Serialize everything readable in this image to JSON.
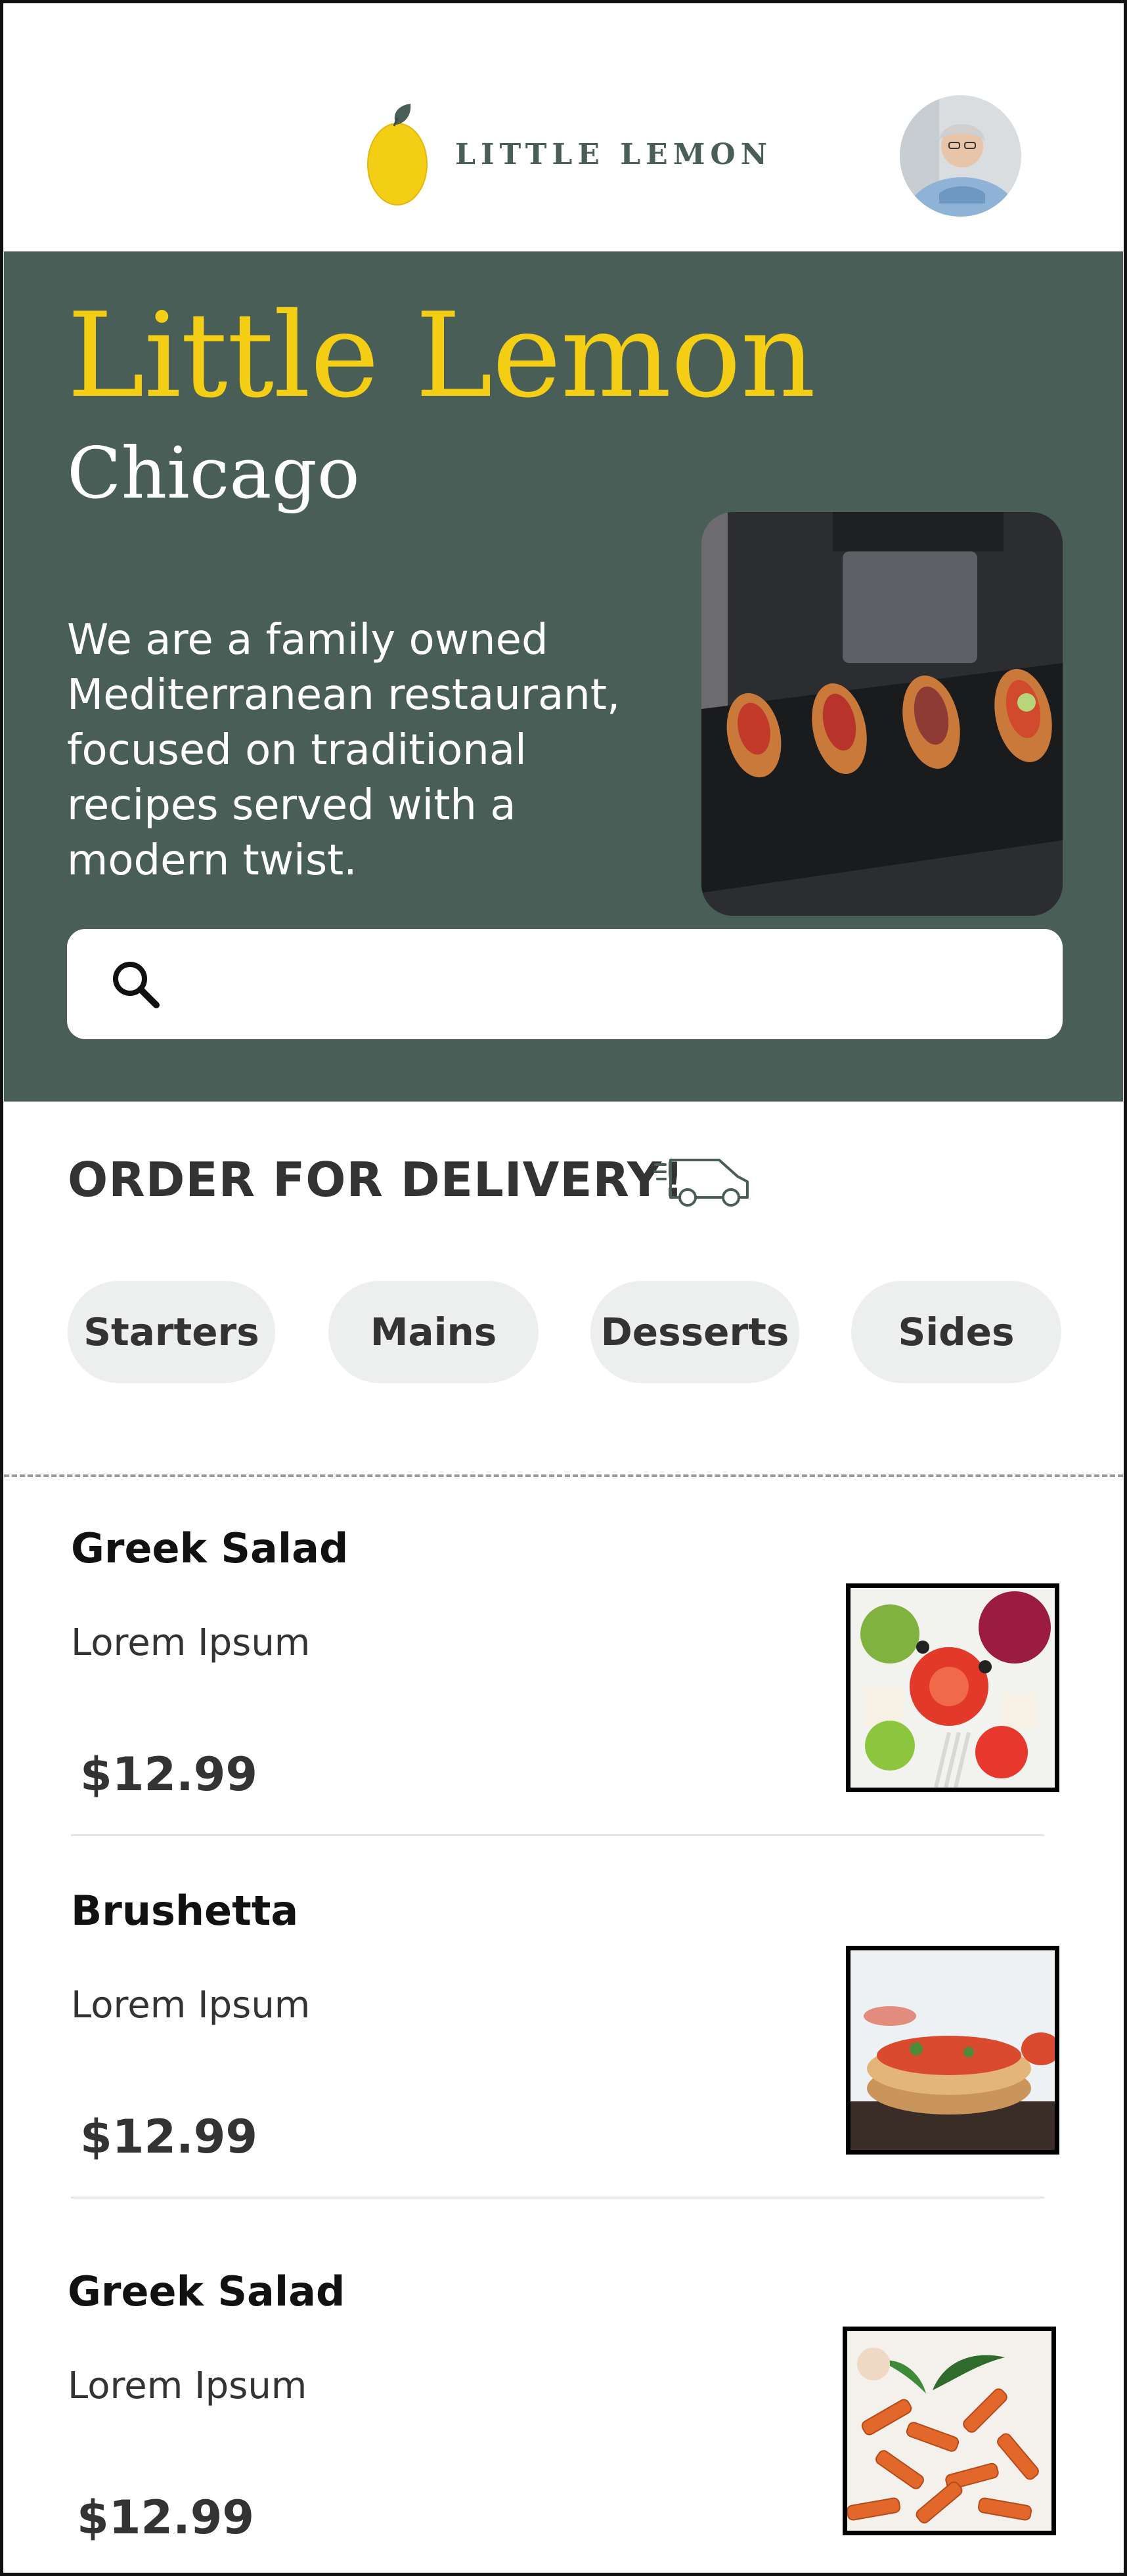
{
  "header": {
    "logo_text": "LITTLE LEMON",
    "icons": {
      "logo": "lemon-icon",
      "avatar": "avatar"
    }
  },
  "hero": {
    "title": "Little Lemon",
    "subtitle": "Chicago",
    "description": "We are a family owned Mediterranean restaurant, focused on traditional recipes served with a modern twist.",
    "search_placeholder": "",
    "colors": {
      "background": "#495E57",
      "title": "#F4CE14"
    }
  },
  "order": {
    "title": "ORDER FOR DELIVERY!",
    "categories": [
      "Starters",
      "Mains",
      "Desserts",
      "Sides"
    ]
  },
  "menu": {
    "items": [
      {
        "name": "Greek Salad",
        "description": "Lorem Ipsum",
        "price": "$12.99",
        "image": "greek-salad-image"
      },
      {
        "name": "Brushetta",
        "description": "Lorem Ipsum",
        "price": "$12.99",
        "image": "bruschetta-image"
      },
      {
        "name": "Greek Salad",
        "description": "Lorem Ipsum",
        "price": "$12.99",
        "image": "pasta-image"
      }
    ]
  }
}
